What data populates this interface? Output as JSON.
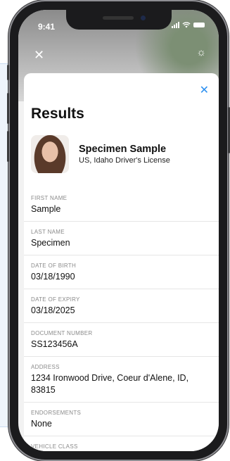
{
  "status": {
    "time": "9:41"
  },
  "sheet": {
    "title": "Results",
    "name": "Specimen Sample",
    "document_type": "US, Idaho Driver's License"
  },
  "fields": [
    {
      "label": "FIRST NAME",
      "value": "Sample"
    },
    {
      "label": "LAST NAME",
      "value": "Specimen"
    },
    {
      "label": "DATE OF BIRTH",
      "value": "03/18/1990"
    },
    {
      "label": "DATE OF EXPIRY",
      "value": "03/18/2025"
    },
    {
      "label": "DOCUMENT NUMBER",
      "value": "SS123456A"
    },
    {
      "label": "ADDRESS",
      "value": "1234 Ironwood Drive, Coeur d'Alene, ID, 83815"
    },
    {
      "label": "ENDORSEMENTS",
      "value": "None"
    },
    {
      "label": "VEHICLE CLASS",
      "value": ""
    }
  ],
  "icons": {
    "close": "close-icon",
    "flash": "flash-icon",
    "signal": "signal-icon",
    "wifi": "wifi-icon",
    "battery": "battery-icon"
  },
  "colors": {
    "accent": "#2b8ff0"
  }
}
